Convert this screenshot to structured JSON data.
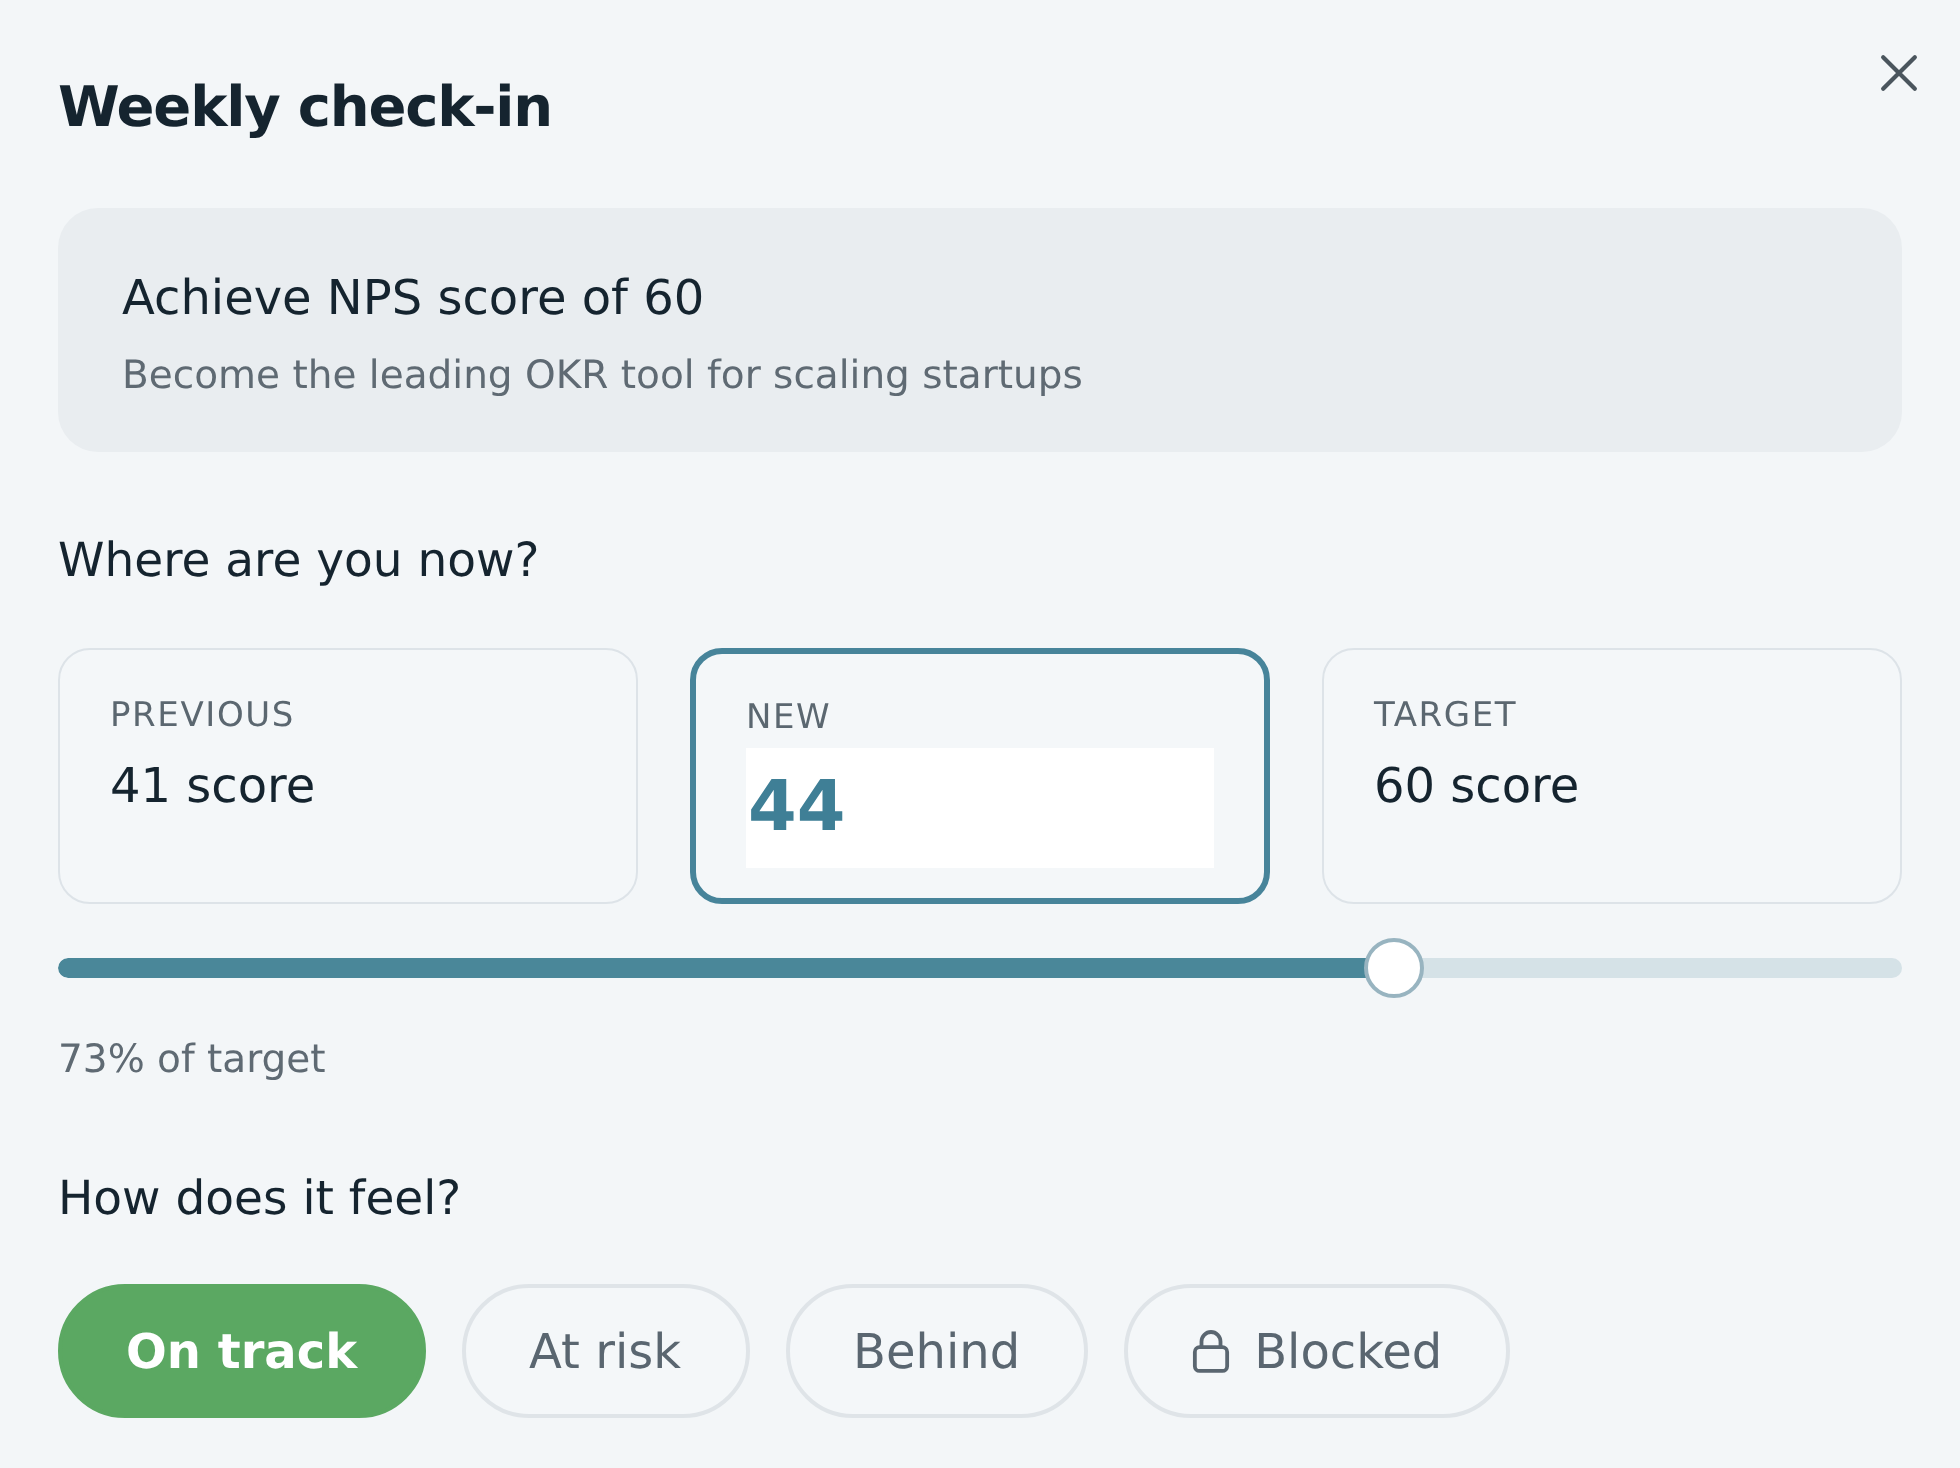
{
  "title": "Weekly check-in",
  "objective": {
    "title": "Achieve NPS score of 60",
    "subtitle": "Become the leading OKR tool for scaling startups"
  },
  "progress_section": {
    "heading": "Where are you now?",
    "values": [
      {
        "kind": "display",
        "label": "PREVIOUS",
        "value": "41 score",
        "focused": false
      },
      {
        "kind": "input",
        "label": "NEW",
        "value": "44",
        "focused": true
      },
      {
        "kind": "display",
        "label": "TARGET",
        "value": "60 score",
        "focused": false
      }
    ],
    "slider": {
      "level": 0.725
    },
    "reading": "73% of target"
  },
  "feeling": {
    "heading": "How does it feel?",
    "options": [
      {
        "label": "On track",
        "selected": true,
        "kind": "plain"
      },
      {
        "label": "At risk",
        "selected": false,
        "kind": "plain"
      },
      {
        "label": "Behind",
        "selected": false,
        "kind": "plain"
      },
      {
        "label": "Blocked",
        "selected": false,
        "kind": "locked"
      }
    ]
  }
}
